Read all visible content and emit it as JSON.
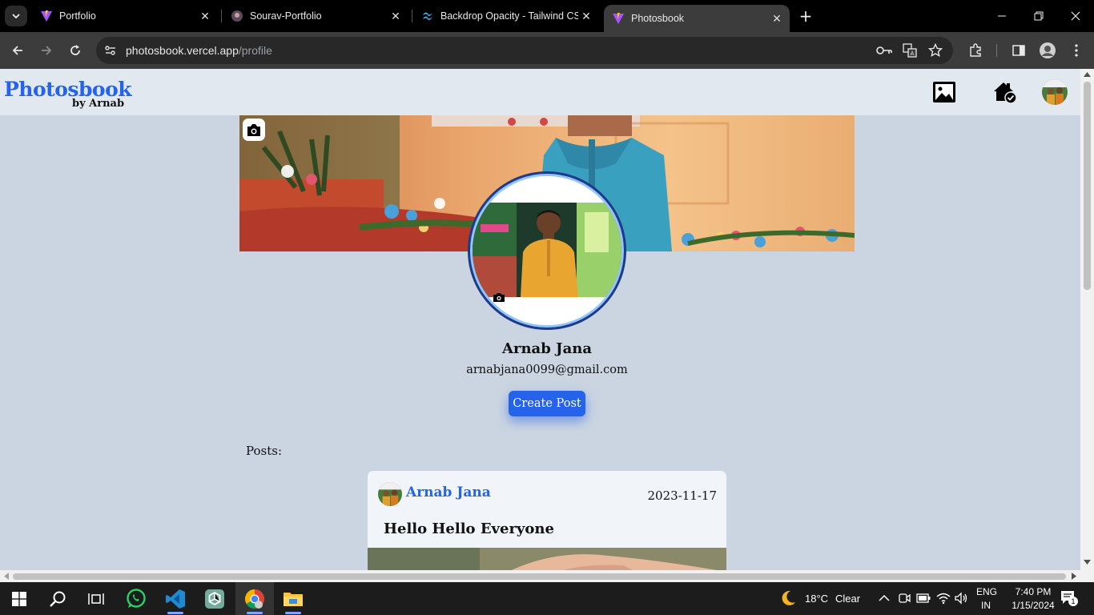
{
  "browser": {
    "tabs": [
      {
        "title": "Portfolio",
        "active": false
      },
      {
        "title": "Sourav-Portfolio",
        "active": false
      },
      {
        "title": "Backdrop Opacity - Tailwind CSS",
        "active": false
      },
      {
        "title": "Photosbook",
        "active": true
      }
    ],
    "url_host": "photosbook.vercel.app",
    "url_path": "/profile"
  },
  "site": {
    "logo": "Photosbook",
    "logo_sub": "by Arnab"
  },
  "profile": {
    "name": "Arnab Jana",
    "email": "arnabjana0099@gmail.com",
    "create_post_label": "Create Post"
  },
  "posts": {
    "label": "Posts:",
    "items": [
      {
        "author": "Arnab Jana",
        "date": "2023-11-17",
        "title": "Hello Hello Everyone"
      }
    ]
  },
  "taskbar": {
    "weather_temp": "18°C",
    "weather_text": "Clear",
    "lang_line1": "ENG",
    "lang_line2": "IN",
    "time": "7:40 PM",
    "date": "1/15/2024",
    "notification_count": "1"
  },
  "colors": {
    "brand": "#2563eb",
    "page_bg": "#cbd5e1",
    "header_bg": "#e2e8f0"
  }
}
